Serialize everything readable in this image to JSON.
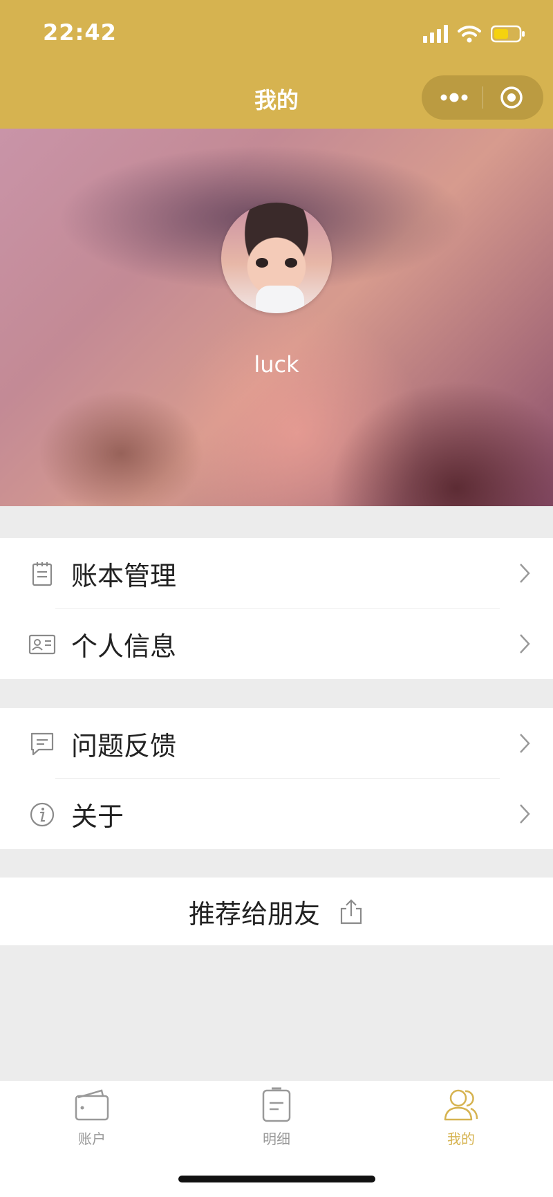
{
  "status_bar": {
    "time": "22:42"
  },
  "nav": {
    "title": "我的"
  },
  "profile": {
    "username": "luck"
  },
  "menu_groups": [
    {
      "items": [
        {
          "label": "账本管理",
          "icon": "notebook-icon"
        },
        {
          "label": "个人信息",
          "icon": "id-card-icon"
        }
      ]
    },
    {
      "items": [
        {
          "label": "问题反馈",
          "icon": "message-icon"
        },
        {
          "label": "关于",
          "icon": "info-icon"
        }
      ]
    }
  ],
  "share": {
    "label": "推荐给朋友",
    "icon": "share-icon"
  },
  "tabs": [
    {
      "label": "账户",
      "icon": "wallet-icon",
      "active": false
    },
    {
      "label": "明细",
      "icon": "list-icon",
      "active": false
    },
    {
      "label": "我的",
      "icon": "users-icon",
      "active": true
    }
  ],
  "colors": {
    "accent": "#d6b350",
    "tab_inactive": "#999999",
    "page_bg": "#ececec"
  }
}
